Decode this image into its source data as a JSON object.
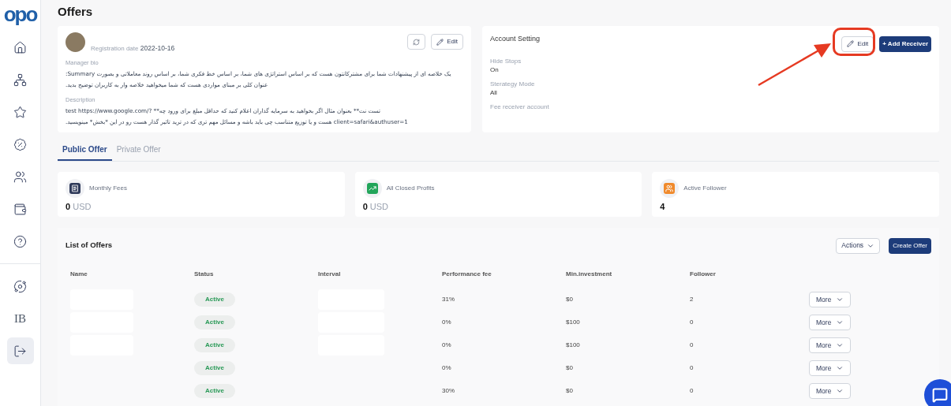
{
  "sidebar": {
    "logo": "opo",
    "items": [
      {
        "kind": "home",
        "selected": false
      },
      {
        "kind": "network",
        "selected": false
      },
      {
        "kind": "star",
        "selected": false
      },
      {
        "kind": "percent",
        "selected": false
      },
      {
        "kind": "users",
        "selected": false
      },
      {
        "kind": "wallet",
        "selected": false
      },
      {
        "kind": "help",
        "selected": false
      },
      {
        "kind": "divider"
      },
      {
        "kind": "circles",
        "selected": false
      },
      {
        "kind": "text",
        "label": "IB",
        "selected": false
      },
      {
        "kind": "logout",
        "selected": true
      }
    ]
  },
  "page_title": "Offers",
  "profile": {
    "registration_label": "Registration date",
    "registration_date": "2022-10-16",
    "edit_button": "Edit",
    "bio_label": "Manager bio",
    "bio": "یک خلاصه ای از پیشنهادات شما برای مشترکانتون هست که بر اساس استراتژی های شما، بر اساس خط فکری شما، بر اساس روند معاملاتی و بصورت Summary: عنوان کلی بر مبنای مواردی هست که شما میخواهید خلاصه وار به کاربران توضیح بدید.",
    "description_label": "Description",
    "description": "تست نت** بعنوان مثال اگر بخواهید به سرمایه گذاران اعلام کنید که حداقل مبلغ برای ورود چه** test https://www.google.com/?client=safari&authuser=1 هست و یا توزیع متناسب چی باید باشه و مسائل مهم تری که در ترید تاثیر گذار هست رو در این *بخش* مینویسید."
  },
  "account_setting": {
    "title": "Account Setting",
    "edit_button": "Edit",
    "edit_highlighted": true,
    "add_button": "+ Add Receiver",
    "fields": [
      {
        "label": "Hide Stops",
        "value": "On"
      },
      {
        "label": "Sterategy Mode",
        "value": "All"
      },
      {
        "label": "Fee receiver account"
      }
    ]
  },
  "tabs": [
    {
      "label": "Public Offer",
      "selected": true
    },
    {
      "label": "Private Offer",
      "selected": false
    }
  ],
  "stats": [
    {
      "kind": "fees",
      "label": "Monthly Fees",
      "value": "0",
      "unit": "USD",
      "color": "#2f3a5a"
    },
    {
      "kind": "profits",
      "label": "All Closed Profits",
      "value": "0",
      "unit": "USD",
      "color": "#22a55a"
    },
    {
      "kind": "followers",
      "label": "Active Follower",
      "value": "4",
      "color": "#f08a2c"
    }
  ],
  "offers": {
    "title": "List of Offers",
    "actions_button": "Actions",
    "create_button": "Create Offer",
    "columns": [
      "Name",
      "Status",
      "Interval",
      "Performance fee",
      "Min.investment",
      "Follower"
    ],
    "rows": [
      {
        "status": "Active",
        "performance_fee": "31%",
        "min_investment": "$0",
        "follower": "2",
        "more": "More"
      },
      {
        "status": "Active",
        "performance_fee": "0%",
        "min_investment": "$100",
        "follower": "0",
        "more": "More"
      },
      {
        "status": "Active",
        "performance_fee": "0%",
        "min_investment": "$100",
        "follower": "0",
        "more": "More"
      },
      {
        "status": "Active",
        "performance_fee": "0%",
        "min_investment": "$0",
        "follower": "0",
        "more": "More"
      },
      {
        "status": "Active",
        "performance_fee": "30%",
        "min_investment": "$0",
        "follower": "0",
        "more": "More"
      }
    ]
  }
}
